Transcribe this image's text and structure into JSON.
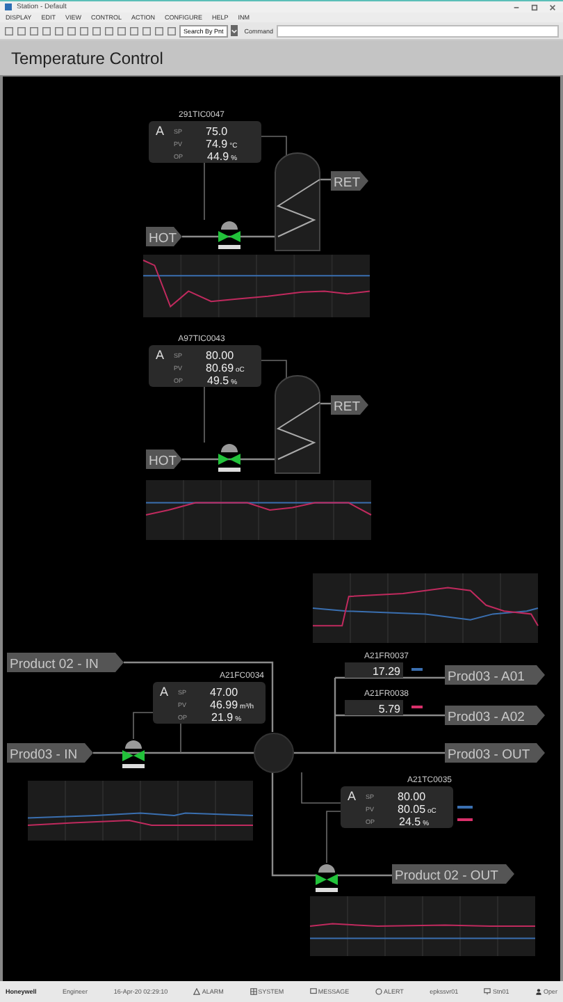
{
  "window": {
    "title": "Station - Default"
  },
  "menu": [
    "DISPLAY",
    "EDIT",
    "VIEW",
    "CONTROL",
    "ACTION",
    "CONFIGURE",
    "HELP",
    "INM"
  ],
  "toolbar": {
    "point_field": "Search By Pnt",
    "command_label": "Command"
  },
  "display_title": "Temperature Control",
  "controllers": [
    {
      "tag": "291TIC0047",
      "mode": "A",
      "rows": [
        {
          "label": "SP",
          "value": "75.0"
        },
        {
          "label": "PV",
          "value": "74.9",
          "unit": "°C"
        },
        {
          "label": "OP",
          "value": "44.9",
          "unit": "%"
        }
      ]
    },
    {
      "tag": "A97TIC0043",
      "mode": "A",
      "rows": [
        {
          "label": "SP",
          "value": "80.00"
        },
        {
          "label": "PV",
          "value": "80.69",
          "unit": "oC"
        },
        {
          "label": "OP",
          "value": "49.5",
          "unit": "%"
        }
      ]
    },
    {
      "tag": "A21FC0034",
      "mode": "A",
      "rows": [
        {
          "label": "SP",
          "value": "47.00"
        },
        {
          "label": "PV",
          "value": "46.99",
          "unit": "m³/h"
        },
        {
          "label": "OP",
          "value": "21.9",
          "unit": "%"
        }
      ]
    },
    {
      "tag": "A21TC0035",
      "mode": "A",
      "rows": [
        {
          "label": "SP",
          "value": "80.00"
        },
        {
          "label": "PV",
          "value": "80.05",
          "unit": "oC"
        },
        {
          "label": "OP",
          "value": "24.5",
          "unit": "%"
        }
      ]
    }
  ],
  "streams": [
    "HOT",
    "RET",
    "HOT",
    "RET",
    "Product 02 - IN",
    "Prod03 - IN",
    "Prod03 - A01",
    "Prod03 - A02",
    "Prod03 - OUT",
    "Product 02 - OUT"
  ],
  "readouts": [
    {
      "tag": "A21FR0037",
      "value": "17.29",
      "color": "#3a6fb0"
    },
    {
      "tag": "A21FR0038",
      "value": "5.79",
      "color": "#d8306a"
    }
  ],
  "status_bar": [
    {
      "kind": "brand",
      "text": "Honeywell"
    },
    {
      "kind": "text",
      "text": "Engineer"
    },
    {
      "kind": "text",
      "text": "16-Apr-20  02:29:10"
    },
    {
      "kind": "alarm",
      "text": "ALARM"
    },
    {
      "kind": "system",
      "text": "SYSTEM"
    },
    {
      "kind": "message",
      "text": "MESSAGE"
    },
    {
      "kind": "alert",
      "text": "ALERT"
    },
    {
      "kind": "text",
      "text": "epkssvr01"
    },
    {
      "kind": "station",
      "text": "Stn01"
    },
    {
      "kind": "user",
      "text": "Oper"
    }
  ]
}
